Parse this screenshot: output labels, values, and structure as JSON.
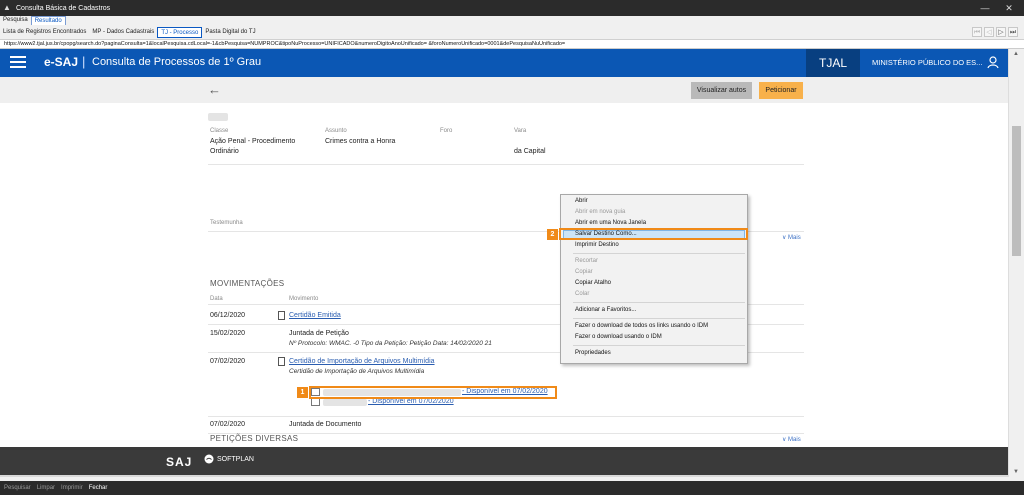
{
  "window": {
    "title": "Consulta Básica de Cadastros",
    "minimize": "—",
    "close": "✕"
  },
  "top_tabs": [
    "Pesquisa",
    "Resultado"
  ],
  "sub_tabs": [
    "Lista de Registros Encontrados",
    "MP - Dados Cadastrais",
    "TJ - Processo",
    "Pasta Digital do TJ"
  ],
  "nav_buttons": [
    "⏮",
    "◁",
    "▷",
    "⏭"
  ],
  "address": "https://www2.tjal.jus.br/cpopg/search.do?paginaConsulta=1&localPesquisa.cdLocal=-1&cbPesquisa=NUMPROC&tipoNuProcesso=UNIFICADO&numeroDigitoAnoUnificado=                                &foroNumeroUnificado=0001&dePesquisaNuUnificado=",
  "header": {
    "brand": "e-SAJ",
    "separator": "|",
    "subtitle": "Consulta de Processos de 1º Grau",
    "court": "TJAL",
    "agency": "MINISTÉRIO PÚBLICO DO ES..."
  },
  "actions": {
    "back": "←",
    "view_autos": "Visualizar autos",
    "petition": "Peticionar"
  },
  "process": {
    "labels": {
      "classe": "Classe",
      "assunto": "Assunto",
      "foro": "Foro",
      "vara": "Vara"
    },
    "classe_line1": "Ação Penal - Procedimento",
    "classe_line2": "Ordinário",
    "assunto": "Crimes contra a Honra",
    "vara": "da Capital",
    "testemunha": "Testemunha",
    "mais": "∨ Mais"
  },
  "movements": {
    "title": "MOVIMENTAÇÕES",
    "col_date": "Data",
    "col_mov": "Movimento",
    "rows": [
      {
        "date": "06/12/2020",
        "text": "Certidão Emitida"
      },
      {
        "date": "15/02/2020",
        "text": "Juntada de Petição",
        "sub": "Nº Protocolo: WMAC.                     -0 Tipo da Petição: Petição Data: 14/02/2020 21"
      },
      {
        "date": "07/02/2020",
        "text": "Certidão de Importação de Arquivos Multimídia",
        "sub": "Certidão de Importação de Arquivos Multimídia"
      },
      {
        "date": "07/02/2020",
        "text": "Juntada de Documento"
      }
    ],
    "attachments": [
      "- Disponível em 07/02/2020",
      "- Disponível em 07/02/2020"
    ],
    "mais": "∨ Mais"
  },
  "petitions": {
    "title": "PETIÇÕES DIVERSAS"
  },
  "footer": {
    "saj": "SAJ",
    "softplan": "SOFTPLAN"
  },
  "markers": [
    "1",
    "2"
  ],
  "context_menu": [
    {
      "label": "Abrir",
      "disabled": false
    },
    {
      "label": "Abrir em nova guia",
      "disabled": true
    },
    {
      "label": "Abrir em uma Nova Janela",
      "disabled": false
    },
    {
      "label": "Salvar Destino Como...",
      "disabled": false
    },
    {
      "label": "Imprimir Destino",
      "disabled": false
    },
    {
      "label": "Recortar",
      "disabled": true
    },
    {
      "label": "Copiar",
      "disabled": true
    },
    {
      "label": "Copiar Atalho",
      "disabled": false
    },
    {
      "label": "Colar",
      "disabled": true
    },
    {
      "label": "Adicionar a Favoritos...",
      "disabled": false
    },
    {
      "label": "Fazer o download de todos os links usando o IDM",
      "disabled": false
    },
    {
      "label": "Fazer o download usando o IDM",
      "disabled": false
    },
    {
      "label": "Propriedades",
      "disabled": false
    }
  ],
  "bottom_bar": [
    "Pesquisar",
    "Limpar",
    "Imprimir",
    "Fechar"
  ],
  "colors": {
    "brand_blue": "#0b57b4",
    "court_blue": "#083f80",
    "accent_orange": "#f08a18",
    "petition_orange": "#f8b14b"
  }
}
